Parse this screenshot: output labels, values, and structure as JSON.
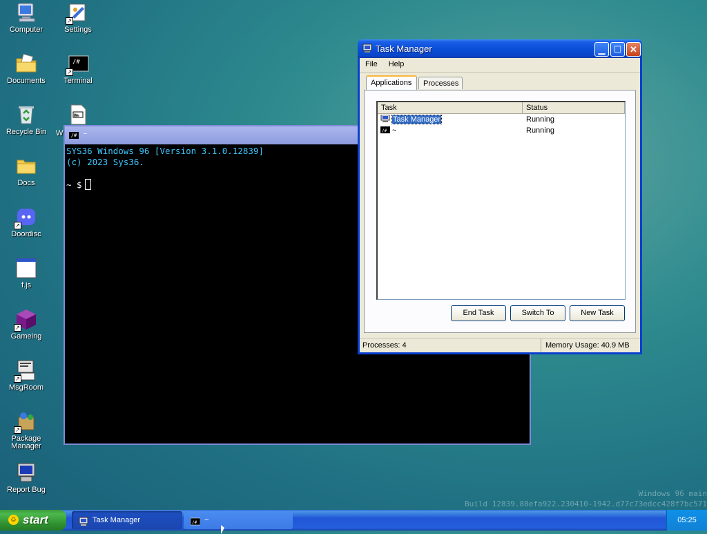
{
  "desktop": {
    "icons": [
      {
        "label": "Computer",
        "icon": "computer-icon"
      },
      {
        "label": "Settings",
        "icon": "settings-icon"
      },
      {
        "label": "Documents",
        "icon": "documents-folder-icon"
      },
      {
        "label": "Terminal",
        "icon": "terminal-icon"
      },
      {
        "label": "Recycle Bin",
        "icon": "recycle-bin-icon"
      },
      {
        "label": "W",
        "icon": "document-icon"
      },
      {
        "label": "Docs",
        "icon": "folder-icon"
      },
      {
        "label": "Doordisc",
        "icon": "doordisc-icon"
      },
      {
        "label": "f.js",
        "icon": "window-file-icon"
      },
      {
        "label": "Gameing",
        "icon": "cube-icon"
      },
      {
        "label": "MsgRoom",
        "icon": "msgroom-icon"
      },
      {
        "label": "Package Manager",
        "icon": "package-icon"
      },
      {
        "label": "Report Bug",
        "icon": "report-bug-icon"
      }
    ]
  },
  "terminal": {
    "title": "~",
    "lines": [
      "SYS36 Windows 96 [Version 3.1.0.12839]",
      "(c) 2023 Sys36."
    ],
    "prompt": "~ $"
  },
  "task_manager": {
    "title": "Task Manager",
    "menu": [
      "File",
      "Help"
    ],
    "tabs": [
      "Applications",
      "Processes"
    ],
    "active_tab": "Applications",
    "columns": [
      "Task",
      "Status"
    ],
    "rows": [
      {
        "task": "Task Manager",
        "status": "Running",
        "selected": true
      },
      {
        "task": "~",
        "status": "Running",
        "selected": false
      }
    ],
    "buttons": {
      "end_task": "End Task",
      "switch_to": "Switch To",
      "new_task": "New Task"
    },
    "status": {
      "processes": "Processes: 4",
      "memory": "Memory Usage: 40.9 MB"
    }
  },
  "taskbar": {
    "start_label": "start",
    "items": [
      {
        "label": "Task Manager"
      },
      {
        "label": "~"
      }
    ],
    "clock": "05:25"
  },
  "watermark": {
    "line1": "Windows 96 main",
    "line2": "Build 12839.88efa922.230410-1942.d77c73edcc428f7bc571"
  },
  "colors": {
    "terminal_text": "#3ec7ff",
    "xp_titlebar": "#0a4fd8",
    "start_green": "#3c9a3c"
  }
}
